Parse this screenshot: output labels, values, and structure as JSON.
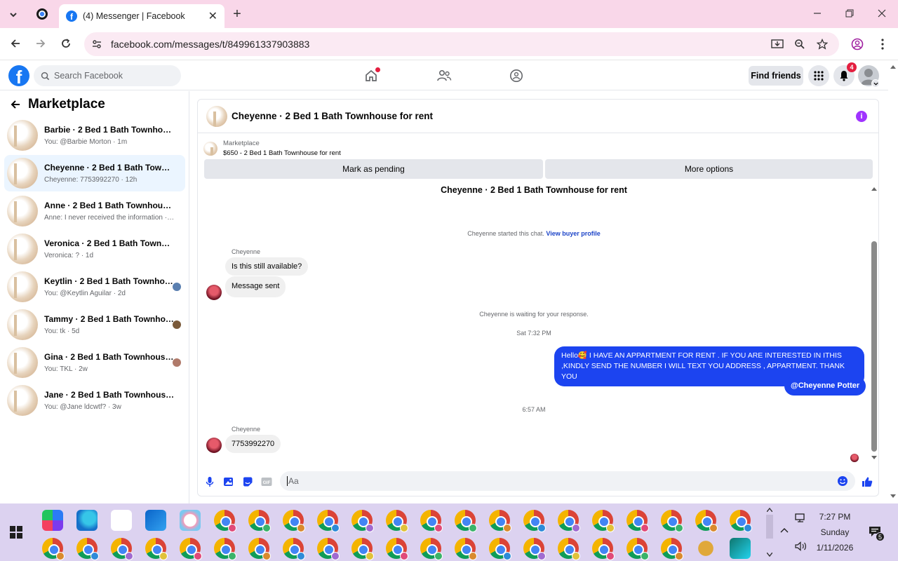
{
  "browser": {
    "tab_title": "(4) Messenger | Facebook",
    "url": "facebook.com/messages/t/849961337903883"
  },
  "fb_header": {
    "search_placeholder": "Search Facebook",
    "find_friends": "Find friends",
    "notification_count": "4"
  },
  "sidebar": {
    "title": "Marketplace",
    "conversations": [
      {
        "title": "Barbie · 2 Bed 1 Bath Townhouse f...",
        "sub": "You: @Barbie Morton · 1m",
        "active": false,
        "read_avatar_color": ""
      },
      {
        "title": "Cheyenne · 2 Bed 1 Bath Townhous...",
        "sub": "Cheyenne: 7753992270 · 12h",
        "active": true,
        "read_avatar_color": ""
      },
      {
        "title": "Anne · 2 Bed 1 Bath Townhouse fo...",
        "sub": "Anne: I never received the information · 1d",
        "active": false,
        "read_avatar_color": ""
      },
      {
        "title": "Veronica · 2 Bed 1 Bath Townhouse...",
        "sub": "Veronica: ? · 1d",
        "active": false,
        "read_avatar_color": ""
      },
      {
        "title": "Keytlin · 2 Bed 1 Bath Townhous...",
        "sub": "You: @Keytlin Aguilar · 2d",
        "active": false,
        "read_avatar_color": "#5a7fb0"
      },
      {
        "title": "Tammy · 2 Bed 1 Bath Townhouse...",
        "sub": "You: tk · 5d",
        "active": false,
        "read_avatar_color": "#7a5a3a"
      },
      {
        "title": "Gina · 2 Bed 1 Bath Townhouse f...",
        "sub": "You: TKL · 2w",
        "active": false,
        "read_avatar_color": "#b07a6a"
      },
      {
        "title": "Jane · 2 Bed 1 Bath Townhouse for ...",
        "sub": "You: @Jane ldcwtf? · 3w",
        "active": false,
        "read_avatar_color": ""
      }
    ]
  },
  "chat": {
    "header_name": "Cheyenne · 2 Bed 1 Bath Townhouse for rent",
    "marketplace_label": "Marketplace",
    "listing": "$650 - 2 Bed 1 Bath Townhouse for rent",
    "mark_pending": "Mark as pending",
    "more_options": "More options",
    "thread_title": "Cheyenne · 2 Bed 1 Bath Townhouse for rent",
    "started_text": "Cheyenne started this chat.",
    "view_profile": "View buyer profile",
    "sender_name": "Cheyenne",
    "msg1": "Is this still available?",
    "msg2": "Message sent",
    "waiting_text": "Cheyenne is waiting for your response.",
    "time1": "Sat 7:32 PM",
    "out_msg_line1": "Hello🥰 I HAVE AN APPARTMENT  FOR RENT . IF YOU ARE INTERESTED IN ITHIS",
    "out_msg_line2": ",KINDLY SEND THE NUMBER I WILL TEXT YOU ADDRESS , APPARTMENT. THANK YOU",
    "out_mention": "@Cheyenne Potter",
    "time2": "6:57 AM",
    "msg3": "7753992270",
    "composer_placeholder": "Aa"
  },
  "taskbar": {
    "time": "7:27 PM",
    "day": "Sunday",
    "date": "1/11/2026",
    "notif_count": "5"
  },
  "colors": {
    "tabbar": "#f9d7e9",
    "fb_blue": "#1877f2",
    "outgoing_bubble": "#1c44f0",
    "taskbar": "#dcd2f0"
  }
}
